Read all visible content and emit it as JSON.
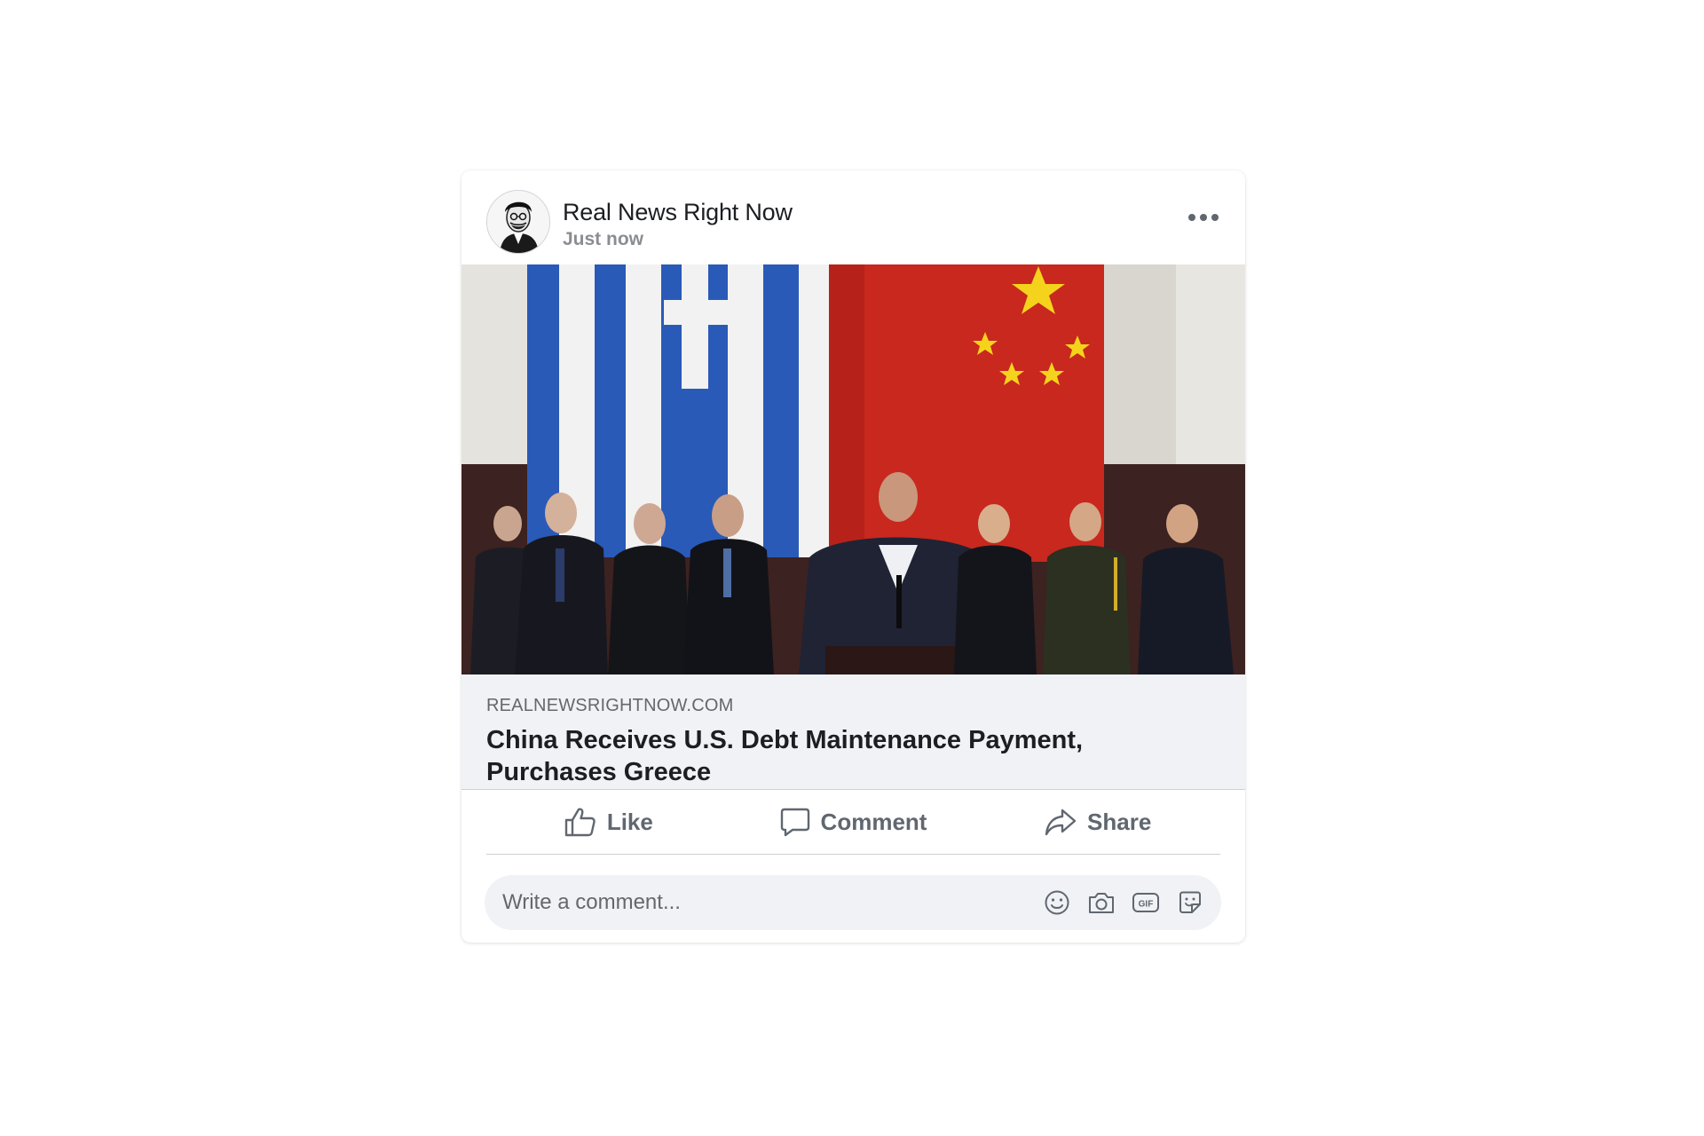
{
  "post": {
    "page_name": "Real News Right Now",
    "timestamp": "Just now",
    "more_icon": "more-horizontal-icon",
    "link": {
      "domain": "REALNEWSRIGHTNOW.COM",
      "headline": "China Receives U.S. Debt Maintenance Payment, Purchases Greece"
    },
    "actions": {
      "like_label": "Like",
      "comment_label": "Comment",
      "share_label": "Share"
    },
    "comment_box": {
      "placeholder": "Write a comment...",
      "icons": [
        "emoji-icon",
        "camera-icon",
        "gif-icon",
        "sticker-icon"
      ]
    }
  },
  "colors": {
    "text_primary": "#1c1e21",
    "text_secondary": "#65676b",
    "link_background": "#f0f2f5",
    "greek_flag_blue": "#2a5ab8",
    "chinese_flag_red": "#c8281e",
    "star_yellow": "#f5d31c"
  }
}
